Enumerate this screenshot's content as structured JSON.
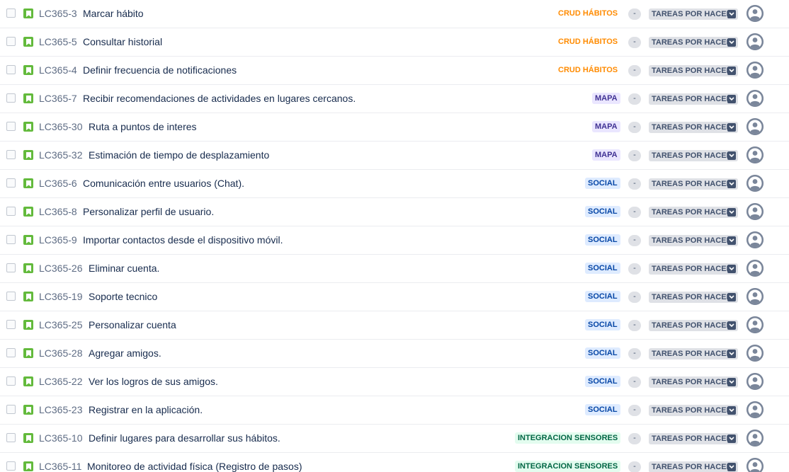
{
  "backlog": {
    "estimate_placeholder": "-",
    "issues": [
      {
        "key": "LC365-3",
        "summary": "Marcar hábito",
        "epic": "CRUD HÁBITOS",
        "epic_style": "crud",
        "status": "TAREAS POR HACER"
      },
      {
        "key": "LC365-5",
        "summary": "Consultar historial",
        "epic": "CRUD HÁBITOS",
        "epic_style": "crud",
        "status": "TAREAS POR HACER"
      },
      {
        "key": "LC365-4",
        "summary": "Definir frecuencia de notificaciones",
        "epic": "CRUD HÁBITOS",
        "epic_style": "crud",
        "status": "TAREAS POR HACER"
      },
      {
        "key": "LC365-7",
        "summary": "Recibir recomendaciones de actividades en lugares cercanos.",
        "epic": "MAPA",
        "epic_style": "mapa",
        "status": "TAREAS POR HACER"
      },
      {
        "key": "LC365-30",
        "summary": "Ruta a puntos de interes",
        "epic": "MAPA",
        "epic_style": "mapa",
        "status": "TAREAS POR HACER"
      },
      {
        "key": "LC365-32",
        "summary": "Estimación de tiempo de desplazamiento",
        "epic": "MAPA",
        "epic_style": "mapa",
        "status": "TAREAS POR HACER"
      },
      {
        "key": "LC365-6",
        "summary": "Comunicación entre usuarios (Chat).",
        "epic": "SOCIAL",
        "epic_style": "social",
        "status": "TAREAS POR HACER"
      },
      {
        "key": "LC365-8",
        "summary": "Personalizar perfil de usuario.",
        "epic": "SOCIAL",
        "epic_style": "social",
        "status": "TAREAS POR HACER"
      },
      {
        "key": "LC365-9",
        "summary": "Importar contactos desde el dispositivo móvil.",
        "epic": "SOCIAL",
        "epic_style": "social",
        "status": "TAREAS POR HACER"
      },
      {
        "key": "LC365-26",
        "summary": "Eliminar cuenta.",
        "epic": "SOCIAL",
        "epic_style": "social",
        "status": "TAREAS POR HACER"
      },
      {
        "key": "LC365-19",
        "summary": "Soporte tecnico",
        "epic": "SOCIAL",
        "epic_style": "social",
        "status": "TAREAS POR HACER"
      },
      {
        "key": "LC365-25",
        "summary": "Personalizar cuenta",
        "epic": "SOCIAL",
        "epic_style": "social",
        "status": "TAREAS POR HACER"
      },
      {
        "key": "LC365-28",
        "summary": "Agregar amigos.",
        "epic": "SOCIAL",
        "epic_style": "social",
        "status": "TAREAS POR HACER"
      },
      {
        "key": "LC365-22",
        "summary": "Ver los logros de sus amigos.",
        "epic": "SOCIAL",
        "epic_style": "social",
        "status": "TAREAS POR HACER"
      },
      {
        "key": "LC365-23",
        "summary": "Registrar en la aplicación.",
        "epic": "SOCIAL",
        "epic_style": "social",
        "status": "TAREAS POR HACER"
      },
      {
        "key": "LC365-10",
        "summary": "Definir lugares para desarrollar sus hábitos.",
        "epic": "INTEGRACION SENSORES",
        "epic_style": "sensores",
        "status": "TAREAS POR HACER"
      },
      {
        "key": "LC365-11",
        "summary": "Monitoreo de actividad física (Registro de pasos)",
        "epic": "INTEGRACION SENSORES",
        "epic_style": "sensores",
        "status": "TAREAS POR HACER"
      }
    ]
  },
  "colors": {
    "story_icon": "#63ba3c",
    "crud_text": "#ff8b00",
    "mapa_text": "#403294",
    "mapa_bg": "#eae6ff",
    "social_text": "#0747a6",
    "social_bg": "#deebff",
    "sensores_text": "#006644",
    "sensores_bg": "#e3fcef",
    "status_bg": "#dfe1e6"
  },
  "icons": {
    "issue_type": "story-bookmark-icon",
    "status_toggle": "chevron-down-icon",
    "assignee": "default-avatar-icon"
  }
}
